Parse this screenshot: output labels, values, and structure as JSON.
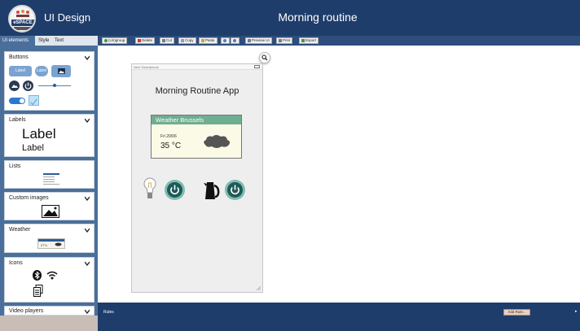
{
  "header": {
    "logo_text": "eSPACE",
    "app_name": "UI Design",
    "page_title": "Morning routine"
  },
  "sidebar": {
    "tabs": [
      {
        "label": "UI elements",
        "active": true
      },
      {
        "label": "Style",
        "active": false
      },
      {
        "label": "Text",
        "active": false
      }
    ],
    "panels": {
      "buttons": {
        "title": "Buttons",
        "button_label_1": "Label",
        "button_label_2": "Label"
      },
      "labels": {
        "title": "Labels",
        "sample_large": "Label",
        "sample_small": "Label"
      },
      "lists": {
        "title": "Lists"
      },
      "custom_images": {
        "title": "Custom images"
      },
      "weather": {
        "title": "Weather",
        "mini_temp": "27°c"
      },
      "icons": {
        "title": "Icons"
      },
      "video_players": {
        "title": "Video players"
      }
    }
  },
  "toolbar": {
    "buttons": [
      {
        "label": "(Un)group",
        "icon": "group-icon"
      },
      {
        "label": "Delete",
        "icon": "delete-icon"
      },
      {
        "label": "Cut",
        "icon": "scissors-icon"
      },
      {
        "label": "Copy",
        "icon": "copy-icon"
      },
      {
        "label": "Paste",
        "icon": "paste-icon"
      },
      {
        "label": "",
        "icon": "undo-icon"
      },
      {
        "label": "",
        "icon": "redo-icon"
      },
      {
        "label": "Preview UI",
        "icon": "preview-icon"
      },
      {
        "label": "Print",
        "icon": "print-icon"
      },
      {
        "label": "Export",
        "icon": "export-icon"
      }
    ]
  },
  "canvas": {
    "phone": {
      "device_name": "Nexi Smartphone",
      "app_title": "Morning Routine App",
      "weather": {
        "title": "Weather Brussels",
        "date": "Fri 20/06",
        "temperature": "35 °C"
      },
      "devices": [
        {
          "name": "lightbulb-icon",
          "power": "on"
        },
        {
          "name": "kettle-icon",
          "power": "on"
        }
      ]
    }
  },
  "rules": {
    "label": "Rules",
    "add_rule_button": "Add Rule..."
  },
  "colors": {
    "header": "#1f3d6b",
    "sidebar": "#4a6f9a",
    "toolbar": "#2d4d7c",
    "weather_header": "#6fae91",
    "power_button": "#1f5a57"
  }
}
